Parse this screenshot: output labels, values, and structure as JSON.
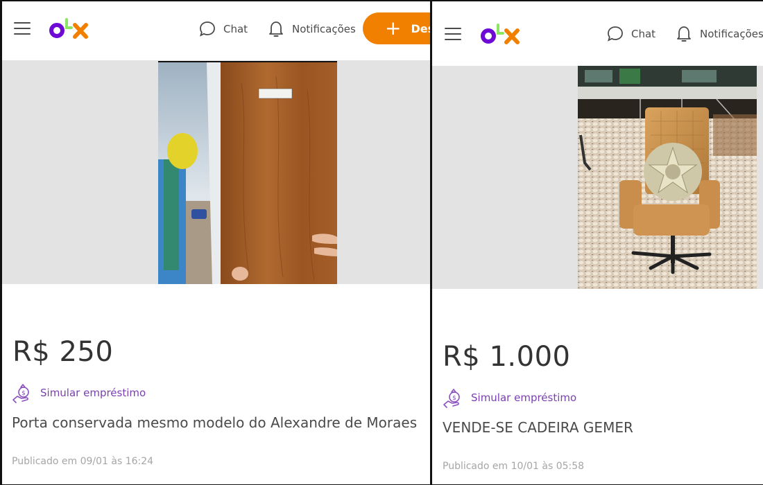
{
  "listings": [
    {
      "header": {
        "menu_icon": "hamburger-menu-icon",
        "logo": "OLX",
        "chat_label": "Chat",
        "notifications_label": "Notificações",
        "cta_label": "Des"
      },
      "photo_description": "Wooden door held by a person at a protest",
      "price": "R$ 250",
      "loan_link": "Simular empréstimo",
      "title": "Porta conservada mesmo modelo do Alexandre de Moraes",
      "published": "Publicado em 09/01 às 16:24"
    },
    {
      "header": {
        "menu_icon": "hamburger-menu-icon",
        "logo": "OLX",
        "chat_label": "Chat",
        "notifications_label": "Notificações"
      },
      "photo_description": "Tan leather office chair with Brazilian coat of arms on a cobblestone plaza",
      "price": "R$ 1.000",
      "loan_link": "Simular empréstimo",
      "title": "VENDE-SE CADEIRA GEMER",
      "published": "Publicado em 10/01 às 05:58"
    }
  ],
  "colors": {
    "brand_purple": "#6e0ad6",
    "brand_green": "#8ce563",
    "brand_orange": "#f28000",
    "loan_purple": "#7a3fb0",
    "gallery_bg": "#e3e3e3"
  }
}
